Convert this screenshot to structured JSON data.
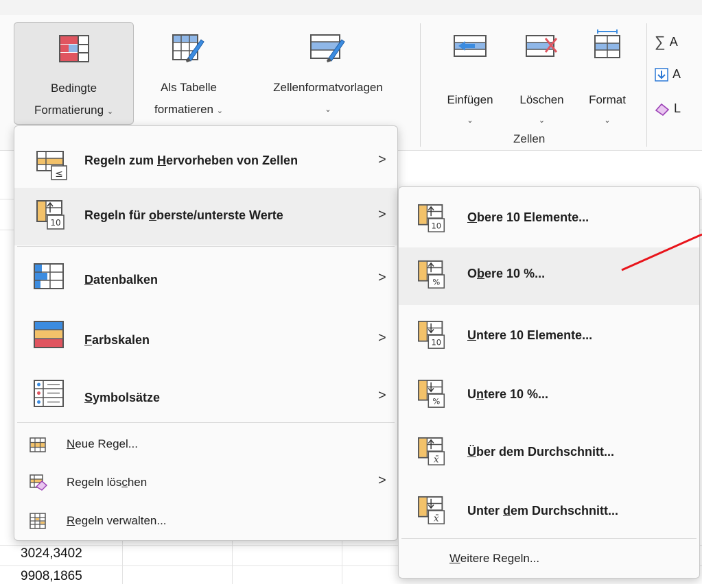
{
  "ribbon": {
    "styles": {
      "conditional_formatting": {
        "line1": "Bedingte",
        "line2": "Formatierung"
      },
      "format_as_table": {
        "line1": "Als Tabelle",
        "line2": "formatieren"
      },
      "cell_styles": {
        "line1": "Zellenformatvorlagen"
      }
    },
    "cells": {
      "insert": "Einfügen",
      "delete": "Löschen",
      "format": "Format",
      "group_label": "Zellen"
    },
    "editing": {
      "autosum": "A",
      "fill": "A",
      "clear": "L"
    }
  },
  "sheet": {
    "cells": [
      "3024,3402",
      "9908,1865"
    ]
  },
  "menu": {
    "items": [
      {
        "pre": "Regeln zum ",
        "key": "H",
        "post": "ervorheben von Zellen",
        "icon": "highlight-cells-rules-icon"
      },
      {
        "pre": "Regeln für ",
        "key": "o",
        "post": "berste/unterste Werte",
        "icon": "top-bottom-rules-icon"
      },
      {
        "pre": "",
        "key": "D",
        "post": "atenbalken",
        "icon": "data-bars-icon"
      },
      {
        "pre": "",
        "key": "F",
        "post": "arbskalen",
        "icon": "color-scales-icon"
      },
      {
        "pre": "",
        "key": "S",
        "post": "ymbolsätze",
        "icon": "icon-sets-icon"
      },
      {
        "pre": "",
        "key": "N",
        "post": "eue Regel...",
        "icon": "new-rule-icon"
      },
      {
        "pre": "Regeln lös",
        "key": "c",
        "post": "hen",
        "icon": "clear-rules-icon"
      },
      {
        "pre": "",
        "key": "R",
        "post": "egeln verwalten...",
        "icon": "manage-rules-icon"
      }
    ]
  },
  "submenu": {
    "items": [
      {
        "pre": "",
        "key": "O",
        "post": "bere 10 Elemente...",
        "badge": "10"
      },
      {
        "pre": "O",
        "key": "b",
        "post": "ere 10 %...",
        "badge": "%"
      },
      {
        "pre": "",
        "key": "U",
        "post": "ntere 10 Elemente...",
        "badge": "10"
      },
      {
        "pre": "U",
        "key": "n",
        "post": "tere 10 %...",
        "badge": "%"
      },
      {
        "pre": "",
        "key": "Ü",
        "post": "ber dem Durchschnitt...",
        "badge": "x̄"
      },
      {
        "pre": "Unter ",
        "key": "d",
        "post": "em Durchschnitt...",
        "badge": "x̄"
      },
      {
        "pre": "",
        "key": "W",
        "post": "eitere Regeln...",
        "badge": ""
      }
    ]
  },
  "colors": {
    "accent_blue": "#2b78d6",
    "accent_red": "#e05560",
    "annotation": "#e8141b"
  }
}
